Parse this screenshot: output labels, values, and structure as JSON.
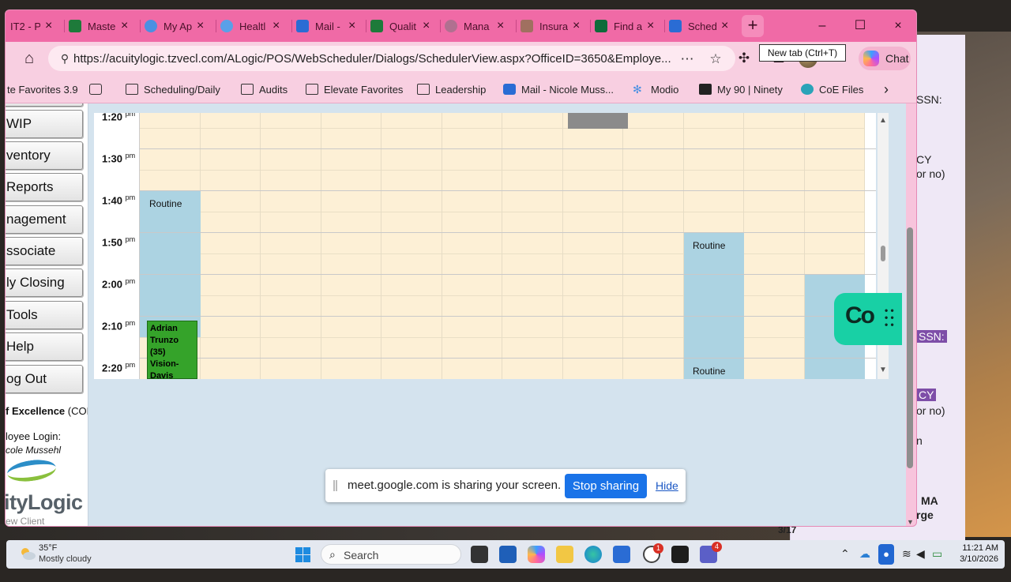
{
  "browser": {
    "tabs": [
      {
        "label": "IT2 - P",
        "color": "#f06aa6"
      },
      {
        "label": "Maste",
        "color": "#1e7a3a"
      },
      {
        "label": "My Ap",
        "color": "#4a90e2"
      },
      {
        "label": "Healtl",
        "color": "#5aa0e8"
      },
      {
        "label": "Mail -",
        "color": "#2a6cd4"
      },
      {
        "label": "Qualit",
        "color": "#1e7a3a"
      },
      {
        "label": "Mana",
        "color": "#b07090"
      },
      {
        "label": "Insura",
        "color": "#a07060"
      },
      {
        "label": "Find a",
        "color": "#0e6b3a"
      },
      {
        "label": "Sched",
        "color": "#2a6cd4"
      }
    ],
    "tab_close": "×",
    "new_tab_symbol": "+",
    "tooltip": "New tab (Ctrl+T)",
    "window_controls": {
      "minimize": "–",
      "maximize": "☐",
      "close": "×"
    },
    "url": "https://acuitylogic.tzvecl.com/ALogic/POS/WebScheduler/Dialogs/SchedulerView.aspx?OfficeID=3650&Employe...",
    "copilot_label": "Chat",
    "bookmarks": [
      {
        "label": "te Favorites 3.9",
        "icon": "none"
      },
      {
        "label": "",
        "icon": "card-icon"
      },
      {
        "label": "Scheduling/Daily",
        "icon": "folder-icon"
      },
      {
        "label": "Audits",
        "icon": "folder-icon"
      },
      {
        "label": "Elevate Favorites",
        "icon": "folder-icon"
      },
      {
        "label": "Leadership",
        "icon": "folder-icon"
      },
      {
        "label": "Mail - Nicole Muss...",
        "icon": "outlook-icon"
      },
      {
        "label": "Modio",
        "icon": "snowflake-icon"
      },
      {
        "label": "My 90 | Ninety",
        "icon": "ninety-icon"
      },
      {
        "label": "CoE Files",
        "icon": "coe-icon"
      }
    ]
  },
  "leftnav": {
    "buttons": [
      "WIP",
      "ventory",
      "Reports",
      "nagement",
      "ssociate",
      "ly Closing",
      "Tools",
      "Help",
      "og Out"
    ],
    "excellence_bold": "f Excellence",
    "excellence_rest": "(COE)",
    "login_label": "loyee Login:",
    "login_name": "cole Mussehl",
    "logo_text": "ityLogic",
    "logo_sub": "ew Client"
  },
  "scheduler": {
    "times": [
      {
        "label": "1:20",
        "suffix": "pm"
      },
      {
        "label": "1:30",
        "suffix": "pm"
      },
      {
        "label": "1:40",
        "suffix": "pm"
      },
      {
        "label": "1:50",
        "suffix": "pm"
      },
      {
        "label": "2:00",
        "suffix": "pm"
      },
      {
        "label": "2:10",
        "suffix": "pm"
      },
      {
        "label": "2:20",
        "suffix": "pm"
      }
    ],
    "routine_label": "Routine",
    "green_appt": {
      "line1": "Adrian",
      "line2": "Trunzo",
      "line3": "(35)",
      "line4": "Vision-",
      "line5": "Davis"
    }
  },
  "overlay": {
    "co_label": "Co",
    "share_text": "meet.google.com is sharing your screen.",
    "stop_label": "Stop sharing",
    "hide_label": "Hide"
  },
  "background_doc": {
    "lines": [
      {
        "text": "SSN:",
        "hl": false
      },
      {
        "text": "CY",
        "hl": false
      },
      {
        "text": "or no)",
        "hl": false
      },
      {
        "text": "SSN:",
        "hl": true
      },
      {
        "text": "CY",
        "hl": true
      },
      {
        "text": "or no)",
        "hl": false
      },
      {
        "text": "n",
        "hl": false
      },
      {
        "text": "MA",
        "hl": false
      },
      {
        "text": "rge",
        "hl": false
      },
      {
        "text": "3/17",
        "hl": false
      }
    ]
  },
  "taskbar": {
    "weather_temp": "35°F",
    "weather_desc": "Mostly cloudy",
    "search_label": "Search",
    "badge_g": "1",
    "badge_teams": "4",
    "time": "11:21 AM",
    "date": "3/10/2026"
  },
  "colors": {
    "tabstrip": "#f06aa6",
    "toolbar": "#f8cfe1",
    "slot_free": "#fdf0d6",
    "slot_routine": "#acd3e2",
    "appt_green": "#35a32a",
    "stop_button": "#1a73e8",
    "co_badge": "#18d0a5"
  }
}
